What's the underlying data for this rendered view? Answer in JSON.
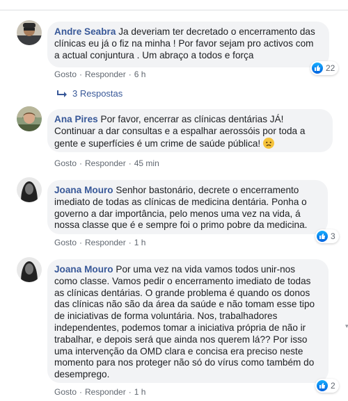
{
  "comments": [
    {
      "author": "Andre Seabra",
      "text": "Ja deveriam ter decretado o encerramento das clínicas eu já o fiz na minha ! Por favor sejam pro activos com a actual conjuntura . Um abraço a todos e força",
      "like_label": "Gosto",
      "reply_label": "Responder",
      "time": "6 h",
      "reactions": "22"
    },
    {
      "author": "Ana Pires",
      "text": "Por favor, encerrar as clínicas dentárias JÁ! Continuar a dar consultas e a espalhar aerossóis por toda a gente e superfícies é um crime de saúde pública!",
      "like_label": "Gosto",
      "reply_label": "Responder",
      "time": "45 min"
    },
    {
      "author": "Joana Mouro",
      "text": "Senhor bastonário, decrete o encerramento imediato de todas as clínicas de medicina dentária. Ponha o governo a dar importância, pelo menos uma vez na vida, á nossa classe que é e sempre foi o primo pobre da medicina.",
      "like_label": "Gosto",
      "reply_label": "Responder",
      "time": "1 h",
      "reactions": "3"
    },
    {
      "author": "Joana Mouro",
      "text": "Por uma vez na vida vamos todos unir-nos como classe. Vamos pedir o encerramento imediato de todas as clínicas dentárias. O grande problema é quando os donos das clínicas não são da área da saúde e não tomam esse tipo de iniciativas de forma voluntária. Nos, trabalhadores independentes, podemos tomar a iniciativa própria de não ir trabalhar, e depois será que ainda nos querem lá?? Por isso uma intervenção da OMD clara e concisa era preciso neste momento para nos proteger não só do vírus como também do desemprego.",
      "like_label": "Gosto",
      "reply_label": "Responder",
      "time": "1 h",
      "reactions": "2"
    }
  ],
  "replies_label": "3 Respostas",
  "colors": {
    "author": "#385898",
    "bubble": "#f2f3f5",
    "like_blue": "#1877f2",
    "meta": "#606770"
  },
  "icons": [
    "reply-arrow-icon",
    "like-reaction-icon",
    "worried-emoji-icon"
  ]
}
